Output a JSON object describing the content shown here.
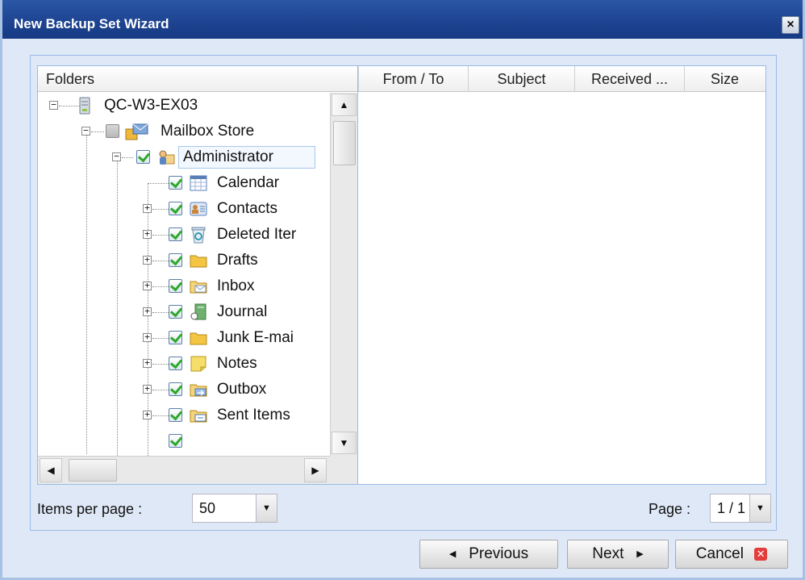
{
  "window": {
    "title": "New Backup Set Wizard",
    "close_label": "×"
  },
  "folders": {
    "header": "Folders",
    "server": "QC-W3-EX03",
    "store": "Mailbox Store",
    "mailbox": "Administrator",
    "items": [
      {
        "label": "Calendar",
        "icon": "calendar-icon"
      },
      {
        "label": "Contacts",
        "icon": "contacts-icon"
      },
      {
        "label": "Deleted Iter",
        "icon": "deleted-items-icon"
      },
      {
        "label": "Drafts",
        "icon": "folder-icon"
      },
      {
        "label": "Inbox",
        "icon": "inbox-icon"
      },
      {
        "label": "Journal",
        "icon": "journal-icon"
      },
      {
        "label": "Junk E-mai",
        "icon": "folder-icon"
      },
      {
        "label": "Notes",
        "icon": "notes-icon"
      },
      {
        "label": "Outbox",
        "icon": "outbox-icon"
      },
      {
        "label": "Sent Items",
        "icon": "sent-items-icon"
      }
    ]
  },
  "grid": {
    "columns": [
      "From / To",
      "Subject",
      "Received ...",
      "Size"
    ]
  },
  "paging": {
    "items_per_page_label": "Items per page :",
    "items_per_page_value": "50",
    "page_label": "Page :",
    "page_value": "1 / 1"
  },
  "buttons": {
    "previous": "Previous",
    "next": "Next",
    "cancel": "Cancel"
  },
  "colors": {
    "titlebar": "#1d4390",
    "panel_bg": "#dfe8f6",
    "border": "#99bbe8",
    "check": "#2ea82e",
    "cancel_icon": "#e23c3c"
  }
}
